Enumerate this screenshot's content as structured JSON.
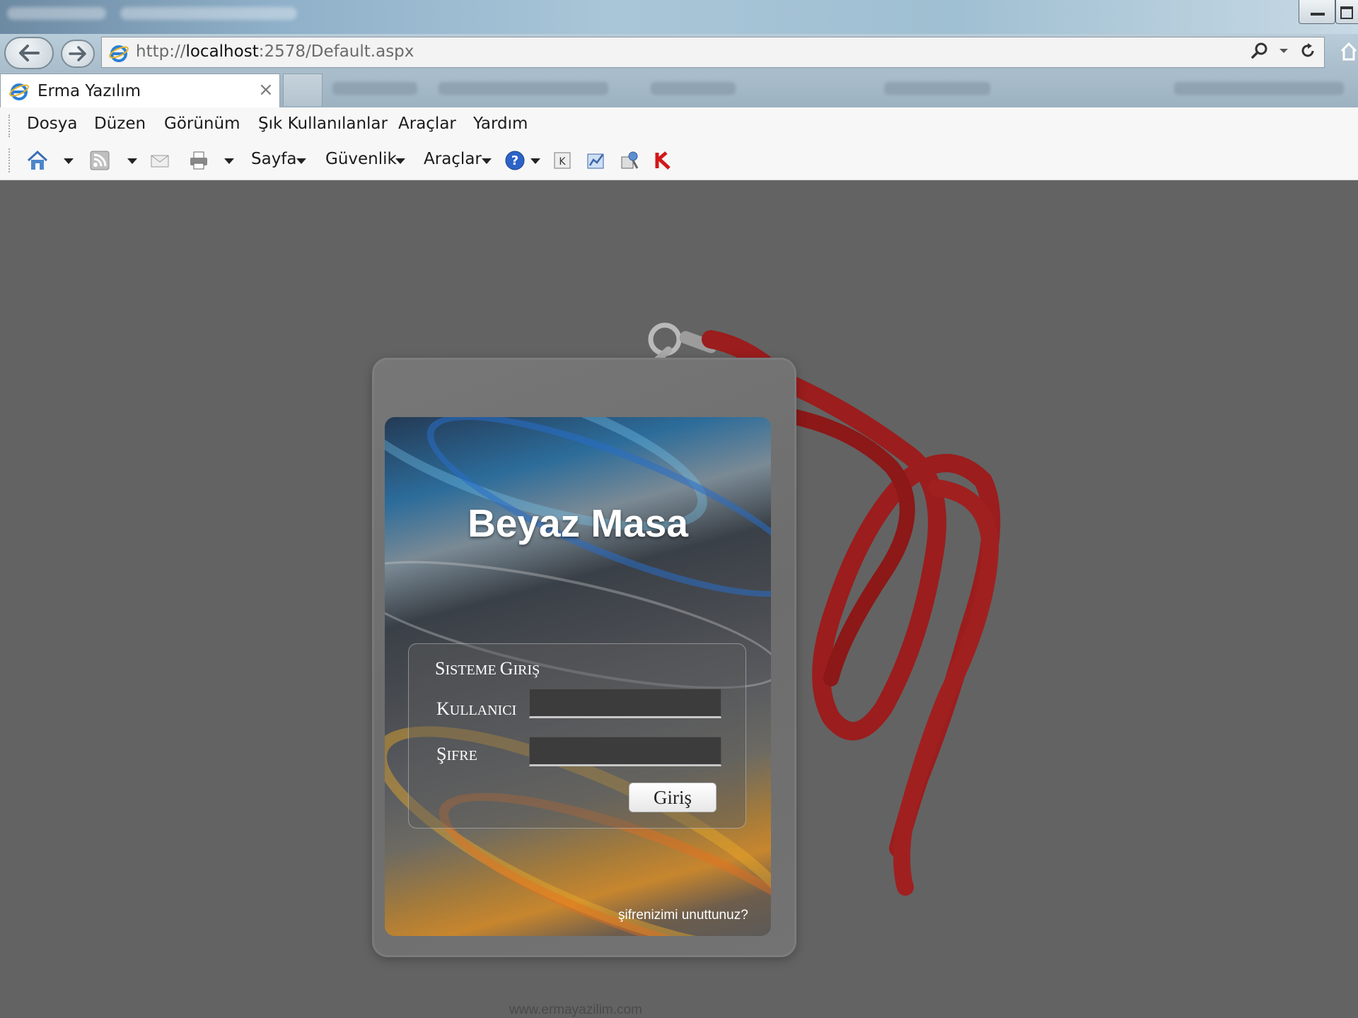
{
  "browser": {
    "address": {
      "scheme": "http://",
      "host": "localhost",
      "rest": ":2578/Default.aspx"
    },
    "tab": {
      "title": "Erma Yazılım",
      "close_glyph": "×"
    },
    "menu": [
      "Dosya",
      "Düzen",
      "Görünüm",
      "Şık Kullanılanlar",
      "Araçlar",
      "Yardım"
    ],
    "commands": {
      "page_label": "Sayfa",
      "safety_label": "Güvenlik",
      "tools_label": "Araçlar"
    },
    "icons": {
      "back": "back-arrow-icon",
      "forward": "forward-arrow-icon",
      "search": "search-icon",
      "refresh": "refresh-icon",
      "home": "home-icon",
      "feeds": "rss-feed-icon",
      "mail": "mail-icon",
      "print": "printer-icon",
      "help": "help-icon",
      "addon1": "addon-k-icon",
      "addon2": "addon-chart-icon",
      "addon3": "addon-tool-icon",
      "addon4": "kaspersky-icon"
    }
  },
  "page": {
    "card_title": "Beyaz Masa",
    "login": {
      "heading_first": "S",
      "heading_rest": "ISTEME ",
      "heading2_first": "G",
      "heading2_rest": "IRIŞ",
      "user_first": "K",
      "user_rest": "ULLANICI",
      "pass_first": "Ş",
      "pass_rest": "IFRE",
      "user_value": "",
      "pass_value": "",
      "submit_label": "Giriş"
    },
    "forgot_link": "şifrenizimi unuttunuz?",
    "footer_url": "www.ermayazilim.com"
  },
  "colors": {
    "page_background": "#636363",
    "lanyard": "#9b1d1d",
    "card_blue": "#2c6c9a",
    "card_orange": "#c7862e"
  }
}
